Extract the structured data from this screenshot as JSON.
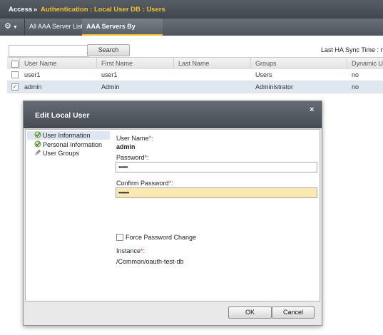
{
  "breadcrumb": {
    "root": "Access",
    "separator": "»",
    "path": "Authentication : Local User DB : Users"
  },
  "tabs": {
    "menu_icon": "gear-icon",
    "tab1": "All AAA Server List",
    "tab2": "AAA Servers By Type"
  },
  "toolbar": {
    "search_button": "Search",
    "search_value": "",
    "ha_sync": "Last HA Sync Time : no"
  },
  "table": {
    "headers": [
      "User Name",
      "First Name",
      "Last Name",
      "Groups",
      "Dynamic Us"
    ],
    "rows": [
      {
        "user": "user1",
        "first": "user1",
        "last": "",
        "groups": "Users",
        "dynamic": "no",
        "checked": false
      },
      {
        "user": "admin",
        "first": "Admin",
        "last": "",
        "groups": "Administrator",
        "dynamic": "no",
        "checked": true
      }
    ]
  },
  "modal": {
    "title": "Edit Local User",
    "close": "×",
    "nav": [
      "User Information",
      "Personal Information",
      "User Groups"
    ],
    "form": {
      "username_label": "User Name",
      "username_value": "admin",
      "password_label": "Password",
      "password_mask": "•••••••",
      "confirm_label": "Confirm Password",
      "confirm_mask": "••••••••",
      "force_change_label": "Force Password Change",
      "instance_label": "Instance",
      "instance_value": "/Common/oauth-test-db",
      "required_mark": "*",
      "colon": ":"
    },
    "buttons": {
      "ok": "OK",
      "cancel": "Cancel"
    }
  },
  "colors": {
    "accent": "#f3c12b",
    "header": "#4a5057",
    "selected_row": "#dfe7f1",
    "confirm_field": "#fbe9b4"
  }
}
